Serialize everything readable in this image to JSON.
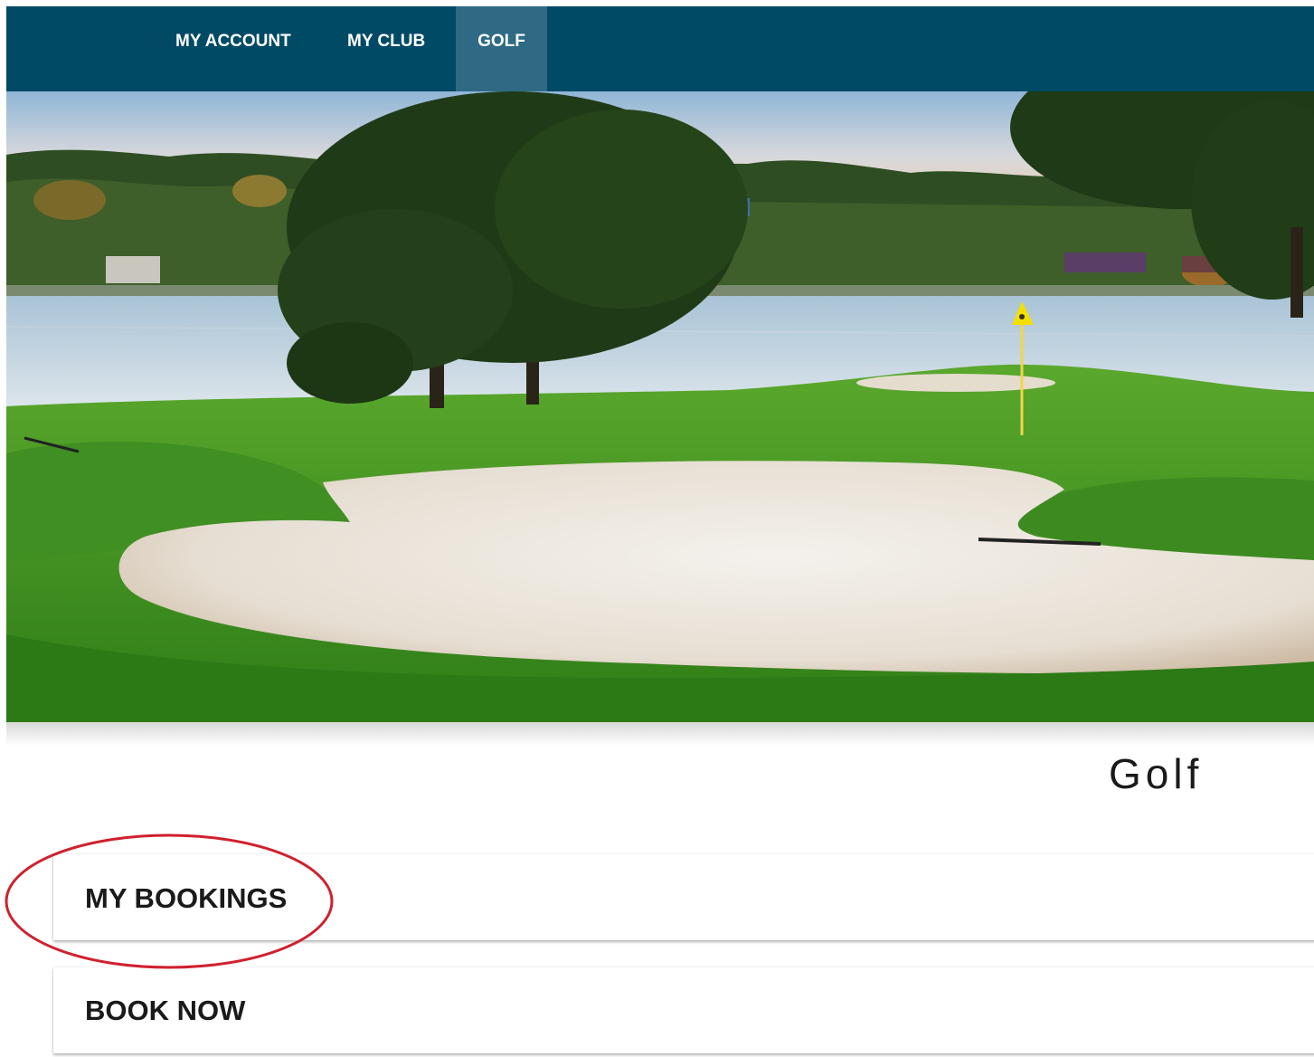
{
  "nav": {
    "tabs": [
      {
        "label": "MY ACCOUNT",
        "active": false
      },
      {
        "label": "MY CLUB",
        "active": false
      },
      {
        "label": "GOLF",
        "active": true
      }
    ],
    "bg_color": "#004a66",
    "active_tab_color": "#2e6a84"
  },
  "hero": {
    "subject": "golf course green with sand bunker, lake and trees"
  },
  "page": {
    "title": "Golf"
  },
  "menu": {
    "items": [
      {
        "label": "MY BOOKINGS",
        "highlighted": true
      },
      {
        "label": "BOOK NOW",
        "highlighted": false
      }
    ]
  },
  "annotation": {
    "color": "#d0202e",
    "shape": "ellipse",
    "target": "MY BOOKINGS"
  }
}
